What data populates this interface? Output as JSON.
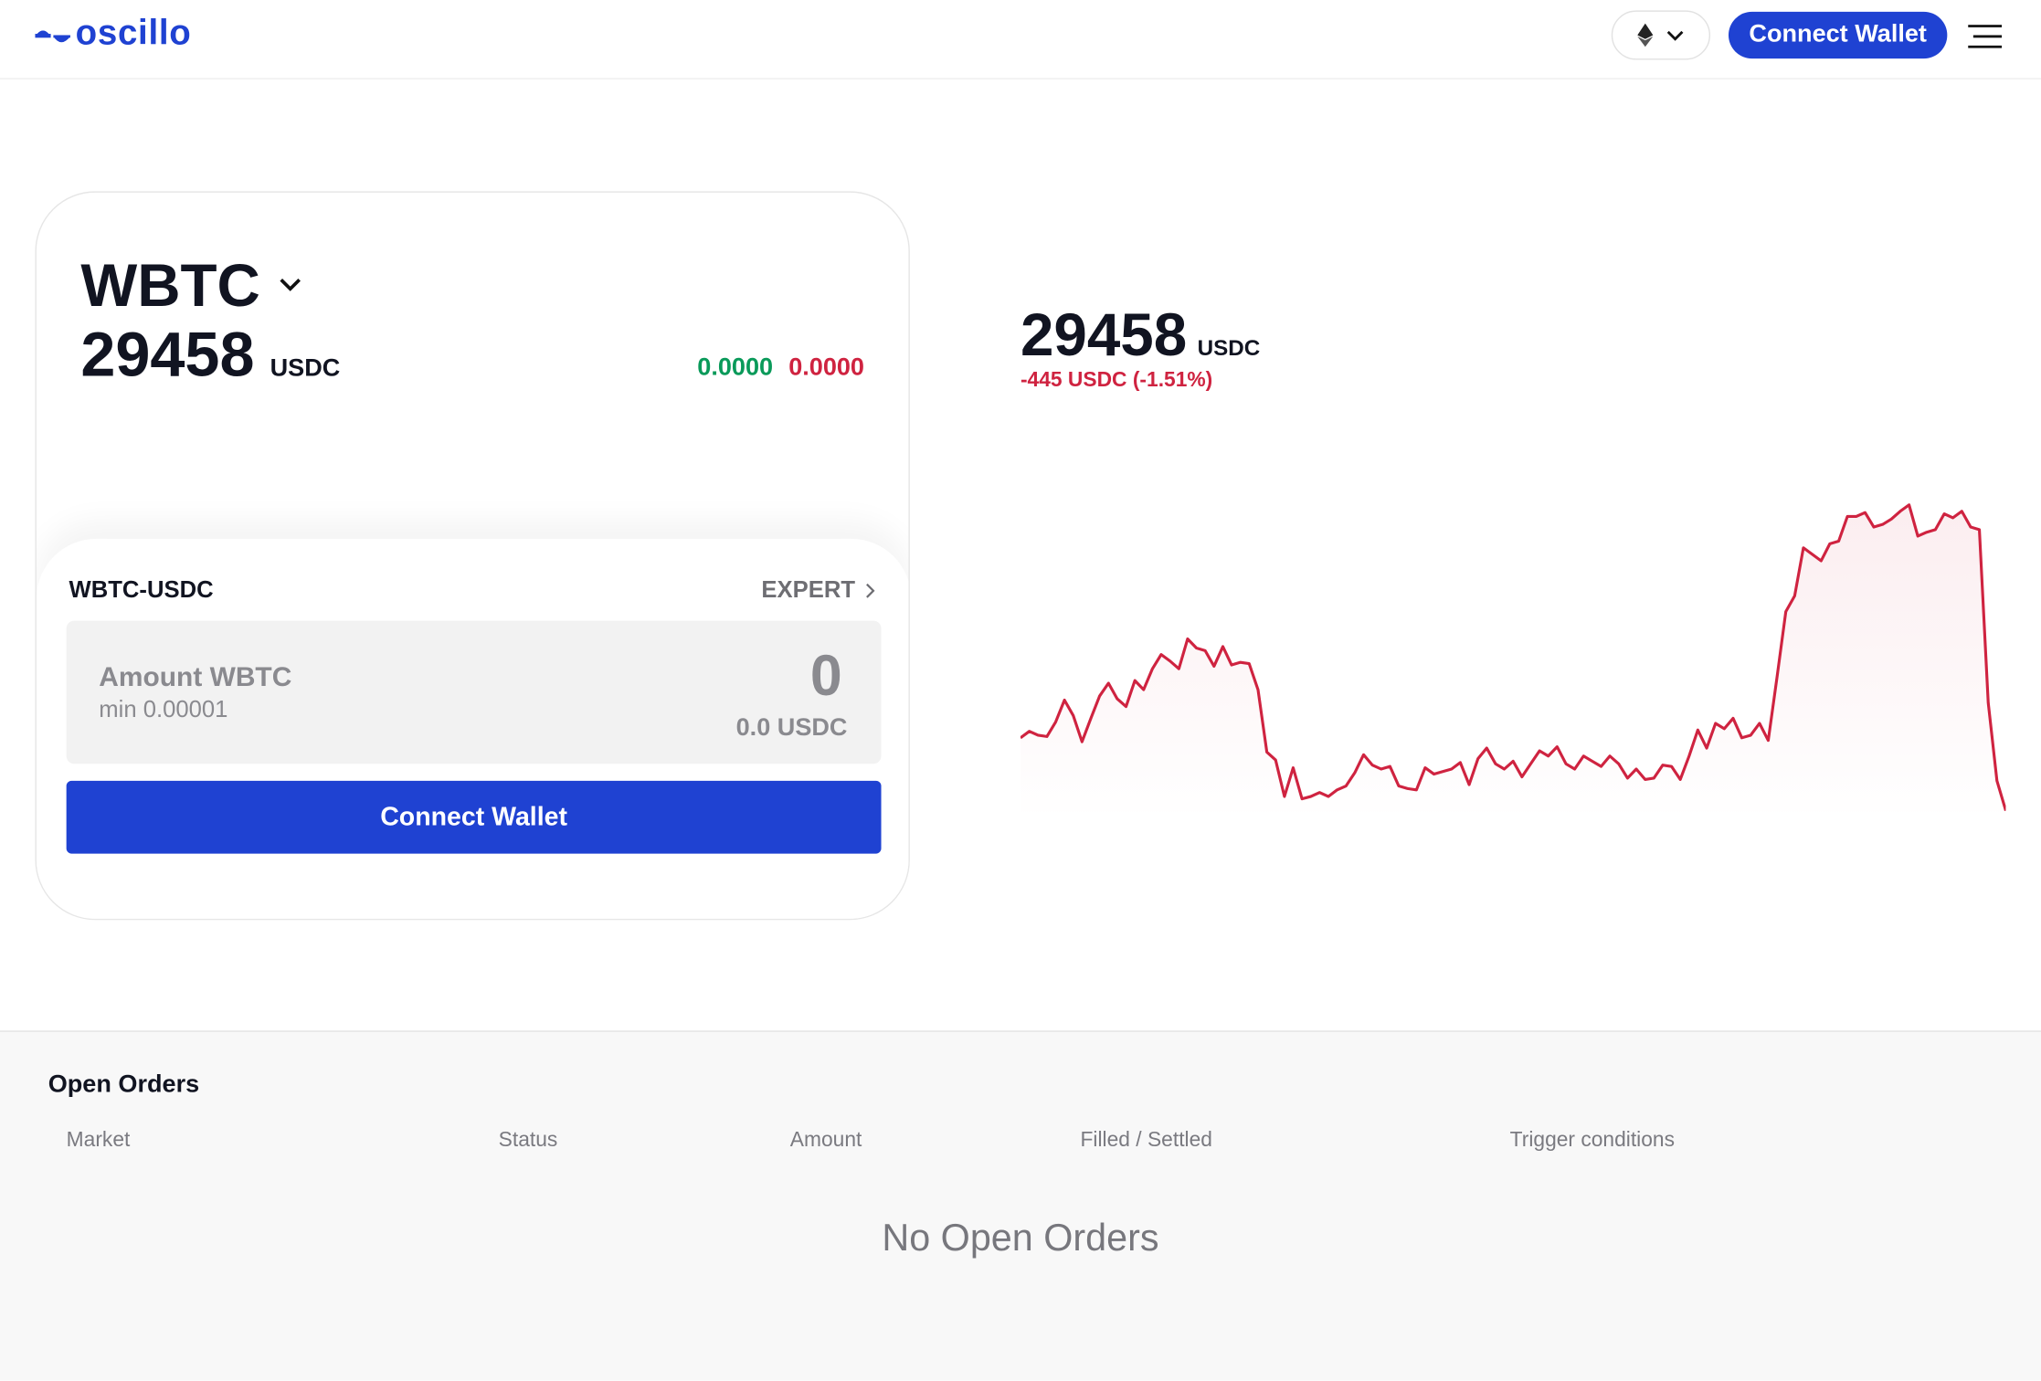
{
  "header": {
    "logo_text": "oscillo",
    "network_icon": "ethereum-icon",
    "connect_wallet_label": "Connect Wallet",
    "menu_icon": "hamburger-icon"
  },
  "trade_card": {
    "asset": "WBTC",
    "price": "29458",
    "price_unit": "USDC",
    "bid": "0.0000",
    "ask": "0.0000",
    "pair": "WBTC-USDC",
    "expert_label": "EXPERT",
    "amount_label": "Amount WBTC",
    "amount_min": "min 0.00001",
    "amount_value": "0",
    "amount_usdc": "0.0 USDC",
    "connect_wallet_label": "Connect Wallet"
  },
  "price_panel": {
    "price": "29458",
    "unit": "USDC",
    "change": "-445 USDC (-1.51%)"
  },
  "colors": {
    "brand": "#1f42d2",
    "up": "#0a9a5a",
    "down": "#cf2340"
  },
  "chart_data": {
    "type": "line",
    "title": "",
    "xlabel": "",
    "ylabel": "USDC",
    "grid": false,
    "ylim": [
      29458,
      31326
    ],
    "values": [
      29903,
      29943,
      29919,
      29911,
      29999,
      30134,
      30038,
      29879,
      30022,
      30158,
      30237,
      30142,
      30094,
      30253,
      30197,
      30325,
      30412,
      30372,
      30325,
      30507,
      30452,
      30436,
      30340,
      30460,
      30348,
      30364,
      30356,
      30197,
      29816,
      29768,
      29545,
      29720,
      29530,
      29545,
      29569,
      29545,
      29585,
      29609,
      29689,
      29800,
      29736,
      29712,
      29728,
      29609,
      29593,
      29585,
      29720,
      29681,
      29697,
      29712,
      29752,
      29617,
      29776,
      29840,
      29744,
      29712,
      29760,
      29665,
      29744,
      29824,
      29792,
      29848,
      29744,
      29712,
      29792,
      29760,
      29728,
      29792,
      29744,
      29657,
      29712,
      29649,
      29657,
      29736,
      29728,
      29649,
      29792,
      29951,
      29840,
      29991,
      29959,
      30022,
      29903,
      29919,
      29991,
      29887,
      30277,
      30674,
      30770,
      31064,
      31024,
      30984,
      31088,
      31104,
      31255,
      31255,
      31279,
      31191,
      31207,
      31239,
      31287,
      31326,
      31135,
      31159,
      31175,
      31271,
      31247,
      31287,
      31191,
      31175,
      30118,
      29641,
      29458
    ]
  },
  "open_orders": {
    "title": "Open Orders",
    "columns": [
      "Market",
      "Status",
      "Amount",
      "Filled / Settled",
      "Trigger conditions"
    ],
    "empty_text": "No Open Orders"
  }
}
